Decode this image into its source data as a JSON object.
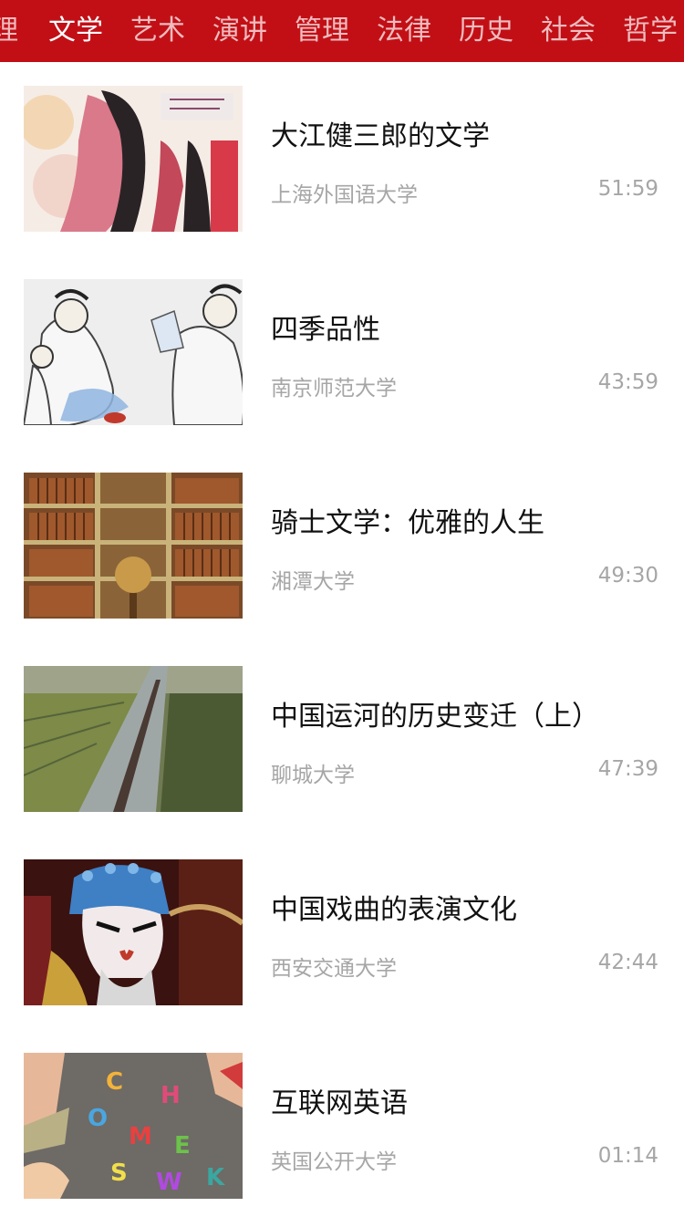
{
  "tabs": [
    {
      "label": "理",
      "active": false
    },
    {
      "label": "文学",
      "active": true
    },
    {
      "label": "艺术",
      "active": false
    },
    {
      "label": "演讲",
      "active": false
    },
    {
      "label": "管理",
      "active": false
    },
    {
      "label": "法律",
      "active": false
    },
    {
      "label": "历史",
      "active": false
    },
    {
      "label": "社会",
      "active": false
    },
    {
      "label": "哲学",
      "active": false
    }
  ],
  "colors": {
    "header_bg": "#c20f16",
    "title_text": "#111111",
    "meta_text": "#a6a6a6"
  },
  "courses": [
    {
      "title": "大江健三郎的文学",
      "source": "上海外国语大学",
      "duration": "51:59",
      "thumb_icon": "ukiyo-e-painting-thumbnail"
    },
    {
      "title": "四季品性",
      "source": "南京师范大学",
      "duration": "43:59",
      "thumb_icon": "ink-painting-scholars-thumbnail"
    },
    {
      "title": "骑士文学：优雅的人生",
      "source": "湘潭大学",
      "duration": "49:30",
      "thumb_icon": "library-bookshelf-thumbnail"
    },
    {
      "title": "中国运河的历史变迁（上）",
      "source": "聊城大学",
      "duration": "47:39",
      "thumb_icon": "canal-aerial-thumbnail"
    },
    {
      "title": "中国戏曲的表演文化",
      "source": "西安交通大学",
      "duration": "42:44",
      "thumb_icon": "opera-mask-thumbnail"
    },
    {
      "title": "互联网英语",
      "source": "英国公开大学",
      "duration": "01:14",
      "thumb_icon": "alphabet-letters-thumbnail"
    }
  ]
}
